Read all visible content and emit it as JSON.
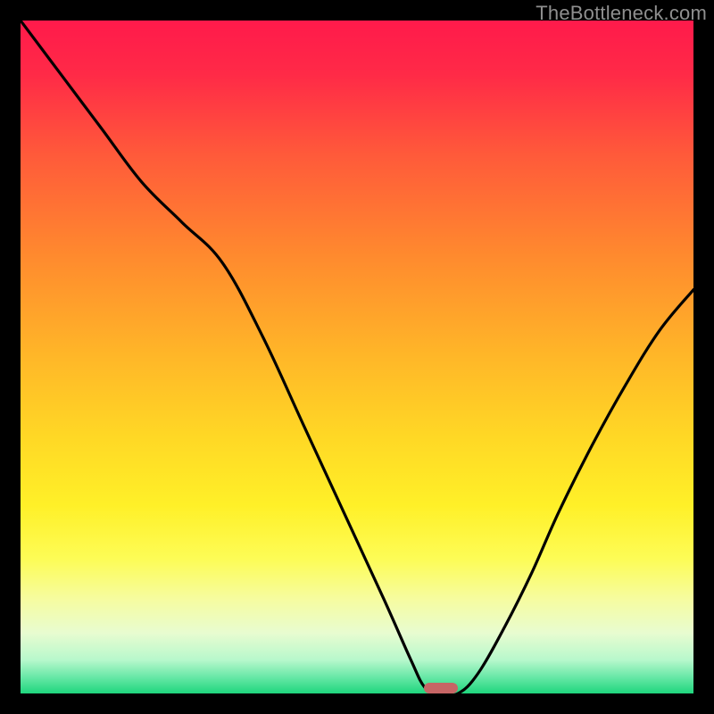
{
  "watermark": "TheBottleneck.com",
  "marker": {
    "x_pct": 62.5,
    "width_pct": 5.0
  },
  "chart_data": {
    "type": "line",
    "title": "",
    "xlabel": "",
    "ylabel": "",
    "xlim": [
      0,
      100
    ],
    "ylim": [
      0,
      100
    ],
    "gradient_stops": [
      {
        "offset": 0.0,
        "color": "#ff1a4b"
      },
      {
        "offset": 0.08,
        "color": "#ff2a47"
      },
      {
        "offset": 0.2,
        "color": "#ff5a3a"
      },
      {
        "offset": 0.35,
        "color": "#ff8a2e"
      },
      {
        "offset": 0.5,
        "color": "#ffb728"
      },
      {
        "offset": 0.62,
        "color": "#ffd825"
      },
      {
        "offset": 0.72,
        "color": "#fff028"
      },
      {
        "offset": 0.8,
        "color": "#fdfc56"
      },
      {
        "offset": 0.86,
        "color": "#f6fca0"
      },
      {
        "offset": 0.91,
        "color": "#e8fcd0"
      },
      {
        "offset": 0.95,
        "color": "#b8f8cc"
      },
      {
        "offset": 0.975,
        "color": "#6ae8a8"
      },
      {
        "offset": 1.0,
        "color": "#1fd67d"
      }
    ],
    "series": [
      {
        "name": "bottleneck-curve",
        "x": [
          0,
          6,
          12,
          18,
          24,
          30,
          36,
          42,
          48,
          54,
          58,
          60,
          62,
          65,
          68,
          72,
          76,
          80,
          85,
          90,
          95,
          100
        ],
        "y": [
          100,
          92,
          84,
          76,
          70,
          64,
          53,
          40,
          27,
          14,
          5,
          1,
          0,
          0,
          3,
          10,
          18,
          27,
          37,
          46,
          54,
          60
        ]
      }
    ]
  }
}
